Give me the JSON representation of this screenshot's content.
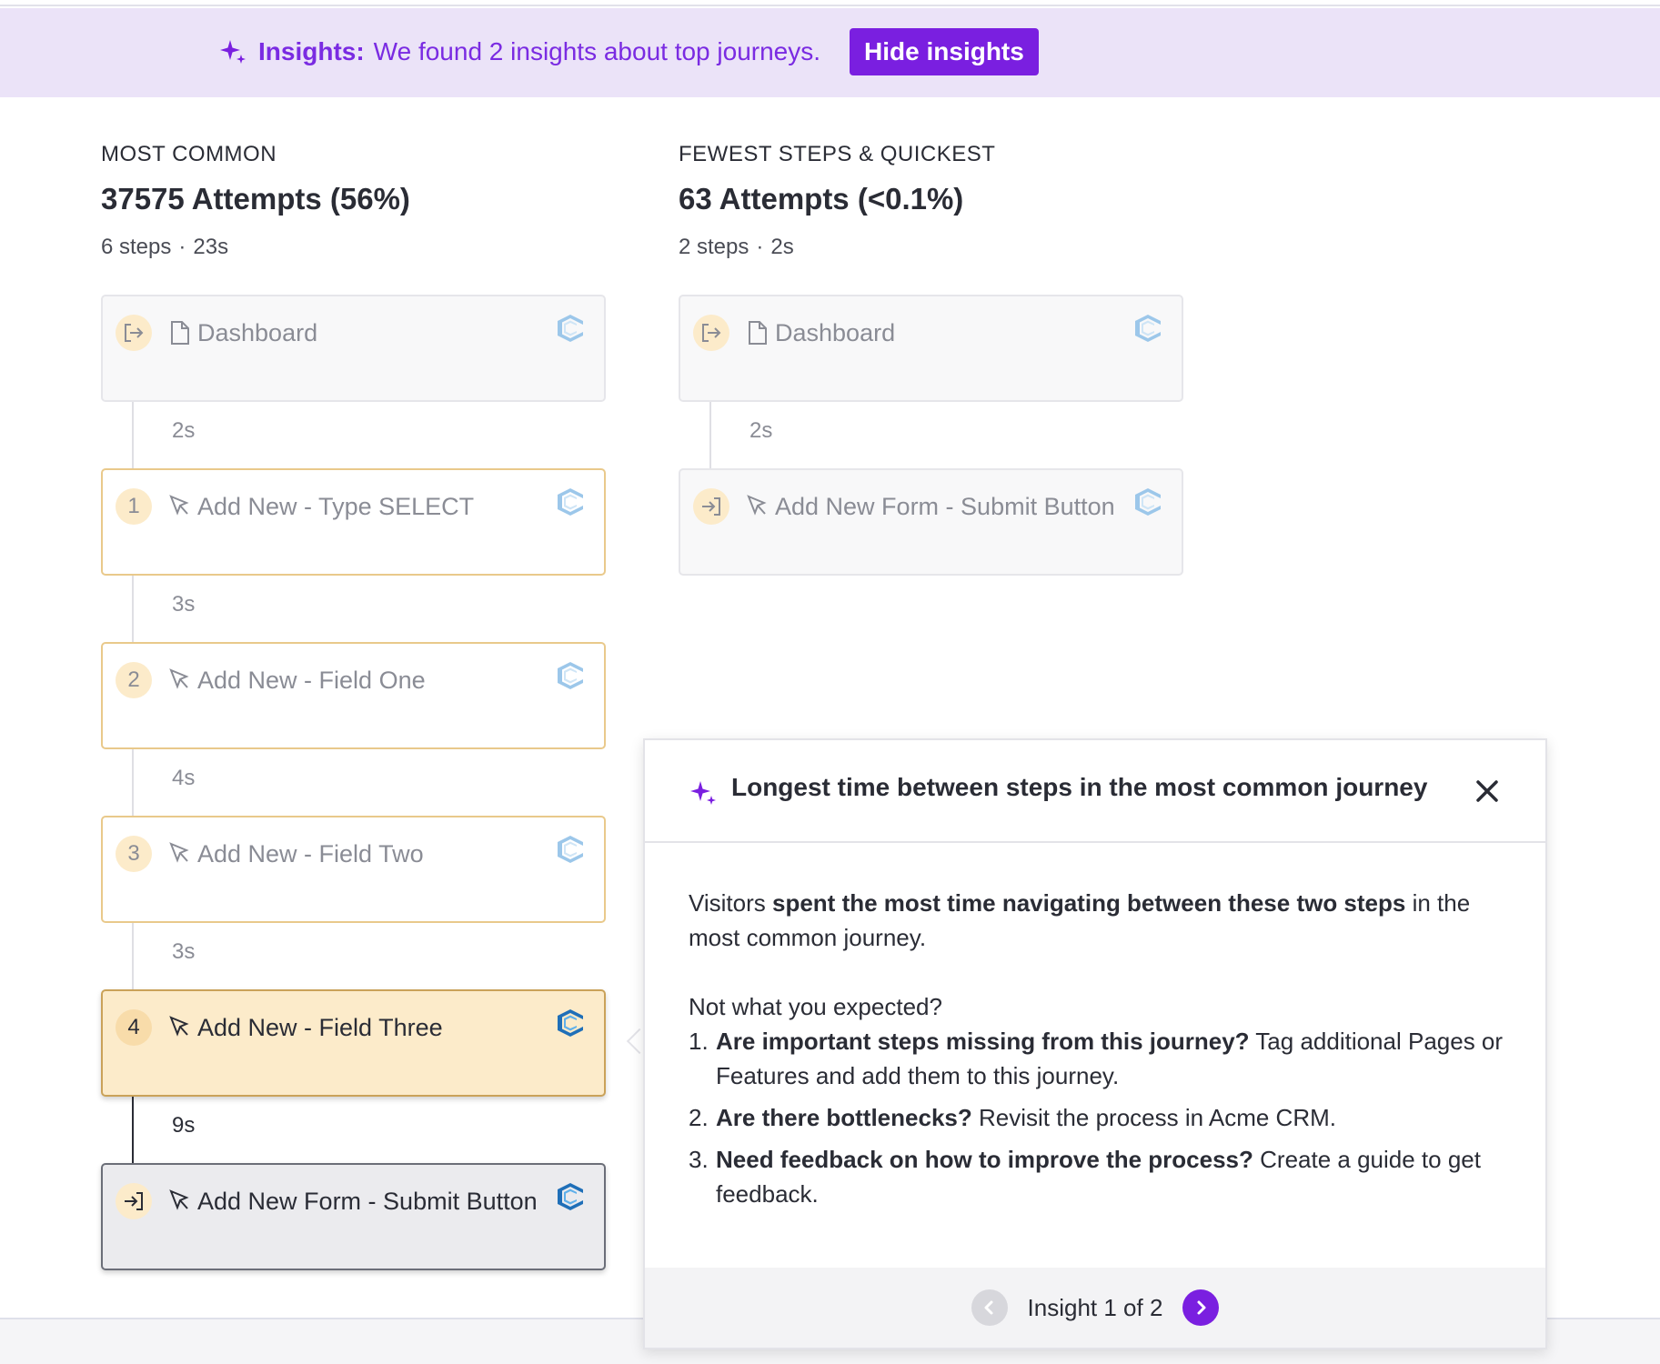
{
  "banner": {
    "title": "Insights:",
    "text": "We found 2 insights about top journeys.",
    "hide_label": "Hide insights",
    "icon": "sparkle-icon"
  },
  "most_common": {
    "label": "MOST COMMON",
    "heading": "37575 Attempts (56%)",
    "steps_count": "6 steps",
    "separator": "·",
    "duration": "23s",
    "steps": [
      {
        "label": "Dashboard",
        "badge": "",
        "badge_icon": "exit-icon",
        "type_icon": "page-icon"
      },
      {
        "label": "Add New - Type SELECT",
        "badge": "1",
        "type_icon": "cursor-icon"
      },
      {
        "label": "Add New - Field One",
        "badge": "2",
        "type_icon": "cursor-icon"
      },
      {
        "label": "Add New - Field Two",
        "badge": "3",
        "type_icon": "cursor-icon"
      },
      {
        "label": "Add New - Field Three",
        "badge": "4",
        "type_icon": "cursor-icon"
      },
      {
        "label": "Add New Form - Submit Button",
        "badge": "",
        "badge_icon": "enter-icon",
        "type_icon": "cursor-icon"
      }
    ],
    "times": [
      "2s",
      "3s",
      "4s",
      "3s",
      "9s"
    ]
  },
  "quickest": {
    "label": "FEWEST STEPS & QUICKEST",
    "heading": "63 Attempts (<0.1%)",
    "steps_count": "2 steps",
    "separator": "·",
    "duration": "2s",
    "steps": [
      {
        "label": "Dashboard",
        "badge_icon": "exit-icon",
        "type_icon": "page-icon"
      },
      {
        "label": "Add New Form - Submit Button",
        "badge_icon": "enter-icon",
        "type_icon": "cursor-icon"
      }
    ],
    "times": [
      "2s"
    ]
  },
  "insight": {
    "title": "Longest time between steps in the most common journey",
    "p1_pre": "Visitors ",
    "p1_bold": "spent the most time navigating between these two steps",
    "p1_post": " in the most common journey.",
    "question": "Not what you expected?",
    "items": [
      {
        "n": "1.",
        "bold": "Are important steps missing from this journey?",
        "text": " Tag additional Pages or Features and add them to this journey."
      },
      {
        "n": "2.",
        "bold": "Are there bottlenecks?",
        "text": " Revisit the process in Acme CRM."
      },
      {
        "n": "3.",
        "bold": "Need feedback on how to improve the process?",
        "text": " Create a guide to get feedback."
      }
    ],
    "pager": "Insight 1 of 2"
  },
  "colors": {
    "accent": "#7a1fe0",
    "banner_bg": "#ebe3f8",
    "step_highlight": "#fcebca",
    "step_border": "#e9c98b"
  }
}
